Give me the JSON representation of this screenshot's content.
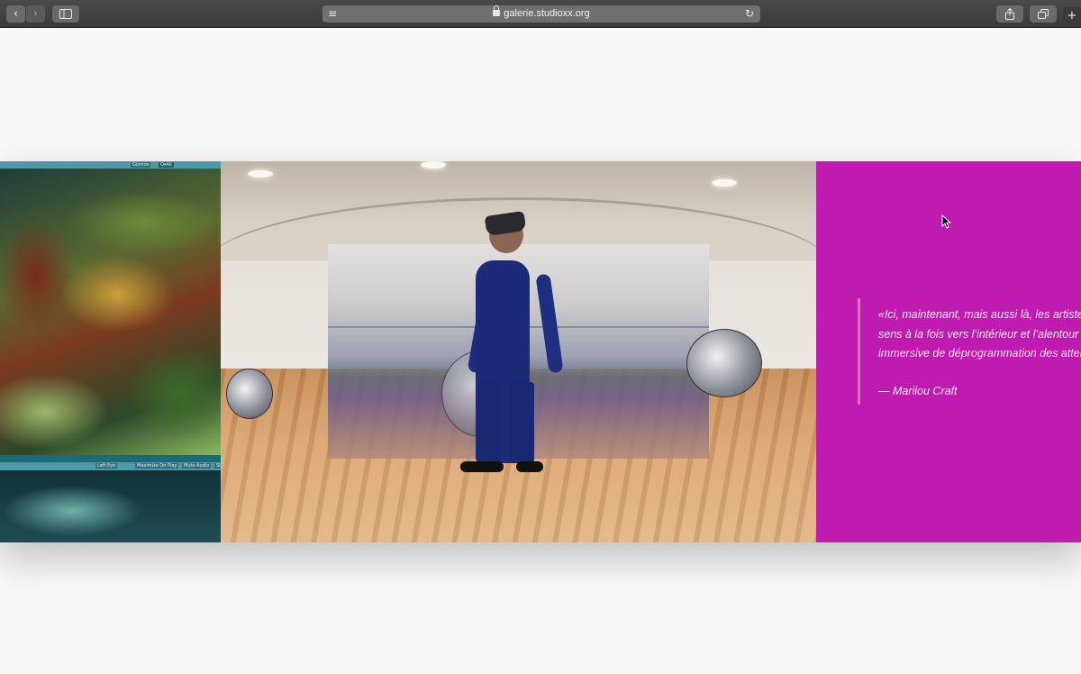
{
  "browser": {
    "url": "galerie.studioxx.org",
    "icons": {
      "back": "chevron-left-icon",
      "forward": "chevron-right-icon",
      "sidebar": "sidebar-icon",
      "reader": "reader-icon",
      "lock": "lock-icon",
      "reload": "reload-icon",
      "share": "share-icon",
      "tabs": "tabs-icon",
      "new_tab": "plus-icon"
    }
  },
  "software_panel": {
    "top_controls": [
      "Gizmos",
      "Q▾All"
    ],
    "bottom_controls": [
      "Left Eye",
      "Maximize On Play",
      "Mute Audio",
      "St"
    ]
  },
  "quote": {
    "lines": [
      "«Ici, maintenant, mais aussi là, les artistes",
      "sens à la fois vers l’intérieur et l’alentour d",
      "immersive de déprogrammation des atter"
    ],
    "author": "— Marilou Craft"
  },
  "colors": {
    "quote_panel": "#c01bb0",
    "toolbar": "#3b3b3b",
    "page_background": "#f7f7f7"
  }
}
